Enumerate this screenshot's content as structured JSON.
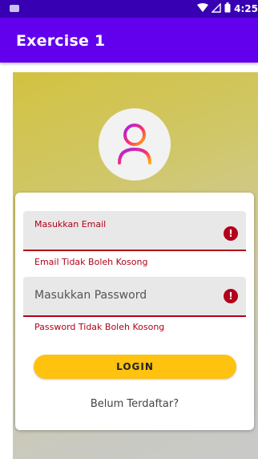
{
  "status_bar": {
    "time": "4:25"
  },
  "app_bar": {
    "title": "Exercise 1"
  },
  "form": {
    "email": {
      "label": "Masukkan Email",
      "error": "Email Tidak Boleh Kosong"
    },
    "password": {
      "label": "Masukkan Password",
      "error": "Password Tidak Boleh Kosong"
    },
    "login_label": "LOGIN",
    "register_label": "Belum Terdaftar?"
  },
  "colors": {
    "app_bar": "#6200ee",
    "status_bar": "#3700b3",
    "error": "#b3001b",
    "button": "#ffc20e"
  },
  "icons": {
    "avatar": "user-icon",
    "error": "error-icon",
    "wifi": "wifi-icon",
    "battery": "battery-icon"
  }
}
